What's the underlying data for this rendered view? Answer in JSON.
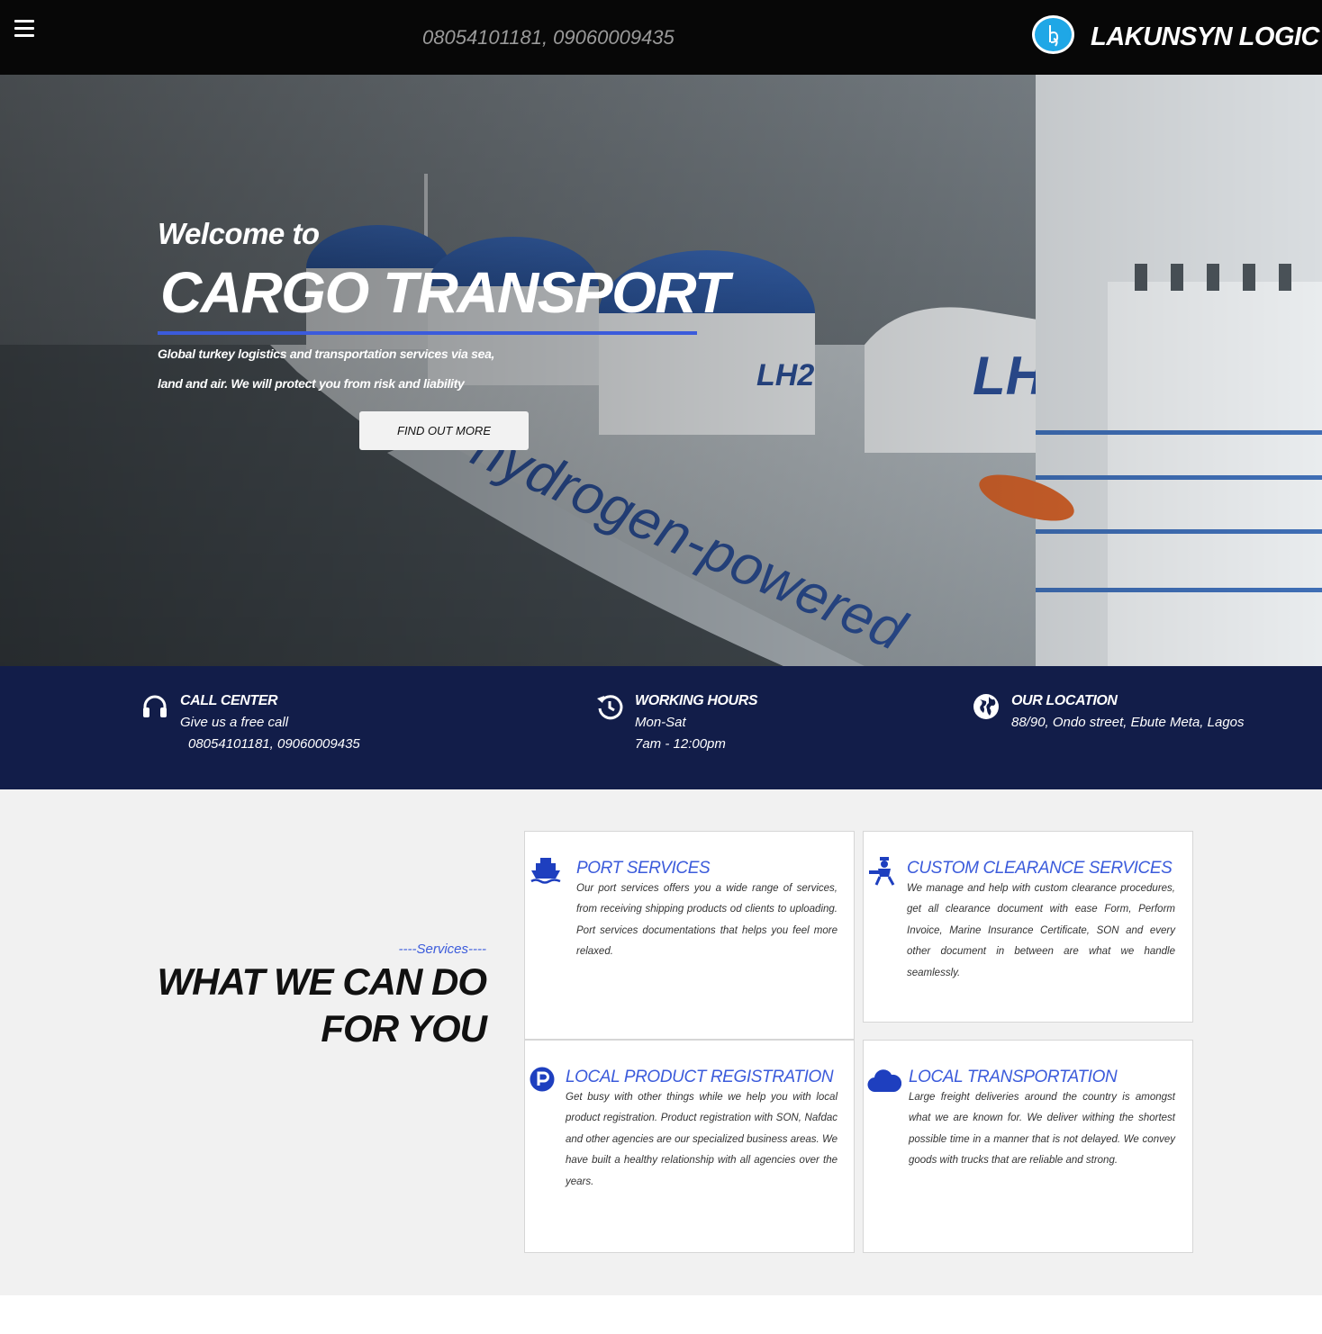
{
  "topbar": {
    "menu_icon": "hamburger-menu-icon",
    "phone": "08054101181, 09060009435",
    "logo_icon": "lakunsyn-logo-icon",
    "brand": "LAKUNSYN LOGIC LT"
  },
  "hero": {
    "welcome": "Welcome to",
    "title": "CARGO TRANSPORT",
    "subtitle": "Global turkey logistics and transportation services via sea, land and air. We will protect you from risk and liability",
    "button": "FIND OUT MORE",
    "accent": "#3b5bdb"
  },
  "info": {
    "call": {
      "icon": "headset-icon",
      "title": "CALL CENTER",
      "line1": "Give us a free call",
      "line2": "08054101181,  09060009435"
    },
    "hours": {
      "icon": "history-clock-icon",
      "title": "WORKING HOURS",
      "line1": "Mon-Sat",
      "line2": "7am - 12:00pm"
    },
    "location": {
      "icon": "globe-icon",
      "title": "OUR LOCATION",
      "line1": "88/90, Ondo street, Ebute Meta, Lagos"
    }
  },
  "services": {
    "eyebrow": "----Services----",
    "heading": "WHAT WE CAN DO FOR YOU",
    "cards": [
      {
        "icon": "ship-icon",
        "title": "PORT SERVICES",
        "body": "Our port services offers you a wide range of services, from receiving shipping products od clients to uploading. Port services documentations that helps you feel more relaxed."
      },
      {
        "icon": "customs-officer-icon",
        "title": "CUSTOM CLEARANCE SERVICES",
        "body": "We manage and help with custom clearance procedures, get all clearance document with ease Form, Perform Invoice, Marine Insurance Certificate, SON and every other document in between are what we handle seamlessly."
      },
      {
        "icon": "parking-p-icon",
        "title": "LOCAL PRODUCT REGISTRATION",
        "body": "Get busy with other things while we help you with local product registration. Product registration with SON, Nafdac and other agencies are our specialized business areas. We have built a healthy relationship with all agencies over the years."
      },
      {
        "icon": "cloud-icon",
        "title": "LOCAL TRANSPORTATION",
        "body": "Large freight deliveries around the country is amongst what we are known for. We deliver withing the shortest possible time in a manner that is not delayed. We convey goods with trucks that are reliable and strong."
      }
    ]
  },
  "colors": {
    "topbar": "#070707",
    "infobar": "#121d49",
    "accent": "#3b5bdb",
    "services_bg": "#f1f1f1"
  }
}
